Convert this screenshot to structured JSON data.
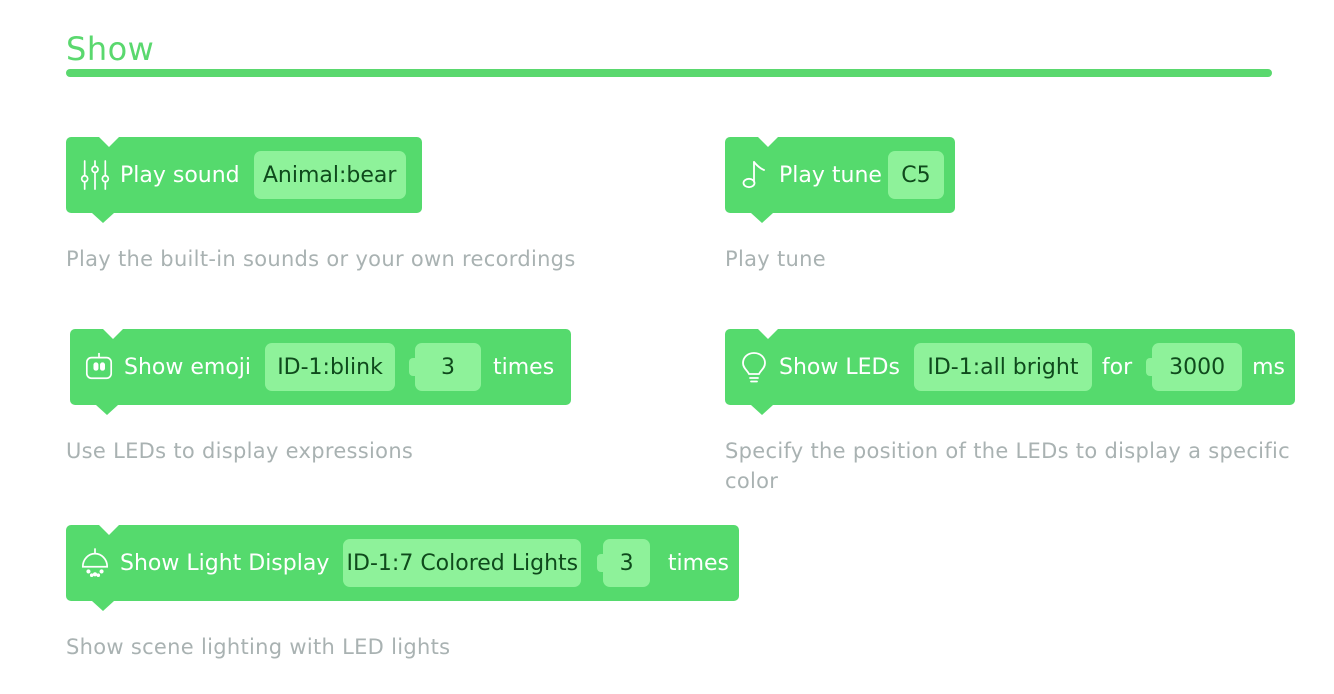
{
  "section": {
    "title": "Show"
  },
  "blocks": [
    {
      "icon": "sliders-icon",
      "label": "Play sound",
      "value": "Animal:bear",
      "description": "Play the built-in sounds or your own recordings"
    },
    {
      "icon": "music-note-icon",
      "label": "Play tune",
      "value": "C5",
      "description": "Play tune"
    },
    {
      "icon": "robot-face-icon",
      "label": "Show emoji",
      "value": "ID-1:blink",
      "count": "3",
      "suffix": "times",
      "description": "Use LEDs to display expressions"
    },
    {
      "icon": "lightbulb-icon",
      "label": "Show LEDs",
      "value": "ID-1:all bright",
      "connector": "for",
      "count": "3000",
      "suffix": "ms",
      "description": "Specify the position of the LEDs to display a specific color"
    },
    {
      "icon": "ceiling-lamp-icon",
      "label": "Show Light Display",
      "value": "ID-1:7 Colored Lights",
      "count": "3",
      "suffix": "times",
      "description": "Show scene lighting with LED lights"
    }
  ],
  "colors": {
    "accent": "#5ad86e",
    "block": "#55da6d",
    "pill": "#8ef29a",
    "description": "#a9b2b2"
  }
}
